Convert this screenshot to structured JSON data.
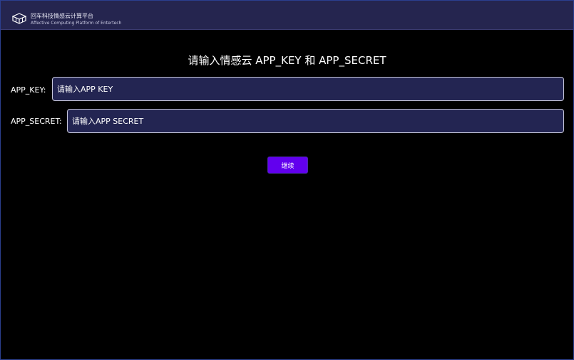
{
  "header": {
    "logo_icon": "cube-logo-icon",
    "title": "回车科技情感云计算平台",
    "subtitle": "Affective Computing Platform of Entertech"
  },
  "form": {
    "title": "请输入情感云 APP_KEY 和 APP_SECRET",
    "app_key": {
      "label": "APP_KEY:",
      "value": "",
      "placeholder": "请输入APP KEY"
    },
    "app_secret": {
      "label": "APP_SECRET:",
      "value": "",
      "placeholder": "请输入APP SECRET"
    },
    "submit_label": "继续"
  },
  "colors": {
    "header_bg": "#25254f",
    "input_bg": "#232552",
    "button_bg": "#6200ee",
    "page_bg": "#000000"
  }
}
